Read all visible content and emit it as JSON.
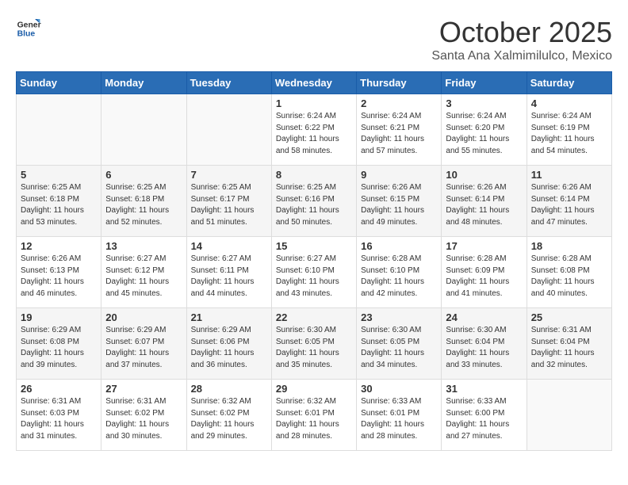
{
  "header": {
    "logo_line1": "General",
    "logo_line2": "Blue",
    "month": "October 2025",
    "location": "Santa Ana Xalmimilulco, Mexico"
  },
  "weekdays": [
    "Sunday",
    "Monday",
    "Tuesday",
    "Wednesday",
    "Thursday",
    "Friday",
    "Saturday"
  ],
  "weeks": [
    [
      {
        "day": "",
        "sunrise": "",
        "sunset": "",
        "daylight": ""
      },
      {
        "day": "",
        "sunrise": "",
        "sunset": "",
        "daylight": ""
      },
      {
        "day": "",
        "sunrise": "",
        "sunset": "",
        "daylight": ""
      },
      {
        "day": "1",
        "sunrise": "6:24 AM",
        "sunset": "6:22 PM",
        "daylight": "11 hours and 58 minutes."
      },
      {
        "day": "2",
        "sunrise": "6:24 AM",
        "sunset": "6:21 PM",
        "daylight": "11 hours and 57 minutes."
      },
      {
        "day": "3",
        "sunrise": "6:24 AM",
        "sunset": "6:20 PM",
        "daylight": "11 hours and 55 minutes."
      },
      {
        "day": "4",
        "sunrise": "6:24 AM",
        "sunset": "6:19 PM",
        "daylight": "11 hours and 54 minutes."
      }
    ],
    [
      {
        "day": "5",
        "sunrise": "6:25 AM",
        "sunset": "6:18 PM",
        "daylight": "11 hours and 53 minutes."
      },
      {
        "day": "6",
        "sunrise": "6:25 AM",
        "sunset": "6:18 PM",
        "daylight": "11 hours and 52 minutes."
      },
      {
        "day": "7",
        "sunrise": "6:25 AM",
        "sunset": "6:17 PM",
        "daylight": "11 hours and 51 minutes."
      },
      {
        "day": "8",
        "sunrise": "6:25 AM",
        "sunset": "6:16 PM",
        "daylight": "11 hours and 50 minutes."
      },
      {
        "day": "9",
        "sunrise": "6:26 AM",
        "sunset": "6:15 PM",
        "daylight": "11 hours and 49 minutes."
      },
      {
        "day": "10",
        "sunrise": "6:26 AM",
        "sunset": "6:14 PM",
        "daylight": "11 hours and 48 minutes."
      },
      {
        "day": "11",
        "sunrise": "6:26 AM",
        "sunset": "6:14 PM",
        "daylight": "11 hours and 47 minutes."
      }
    ],
    [
      {
        "day": "12",
        "sunrise": "6:26 AM",
        "sunset": "6:13 PM",
        "daylight": "11 hours and 46 minutes."
      },
      {
        "day": "13",
        "sunrise": "6:27 AM",
        "sunset": "6:12 PM",
        "daylight": "11 hours and 45 minutes."
      },
      {
        "day": "14",
        "sunrise": "6:27 AM",
        "sunset": "6:11 PM",
        "daylight": "11 hours and 44 minutes."
      },
      {
        "day": "15",
        "sunrise": "6:27 AM",
        "sunset": "6:10 PM",
        "daylight": "11 hours and 43 minutes."
      },
      {
        "day": "16",
        "sunrise": "6:28 AM",
        "sunset": "6:10 PM",
        "daylight": "11 hours and 42 minutes."
      },
      {
        "day": "17",
        "sunrise": "6:28 AM",
        "sunset": "6:09 PM",
        "daylight": "11 hours and 41 minutes."
      },
      {
        "day": "18",
        "sunrise": "6:28 AM",
        "sunset": "6:08 PM",
        "daylight": "11 hours and 40 minutes."
      }
    ],
    [
      {
        "day": "19",
        "sunrise": "6:29 AM",
        "sunset": "6:08 PM",
        "daylight": "11 hours and 39 minutes."
      },
      {
        "day": "20",
        "sunrise": "6:29 AM",
        "sunset": "6:07 PM",
        "daylight": "11 hours and 37 minutes."
      },
      {
        "day": "21",
        "sunrise": "6:29 AM",
        "sunset": "6:06 PM",
        "daylight": "11 hours and 36 minutes."
      },
      {
        "day": "22",
        "sunrise": "6:30 AM",
        "sunset": "6:05 PM",
        "daylight": "11 hours and 35 minutes."
      },
      {
        "day": "23",
        "sunrise": "6:30 AM",
        "sunset": "6:05 PM",
        "daylight": "11 hours and 34 minutes."
      },
      {
        "day": "24",
        "sunrise": "6:30 AM",
        "sunset": "6:04 PM",
        "daylight": "11 hours and 33 minutes."
      },
      {
        "day": "25",
        "sunrise": "6:31 AM",
        "sunset": "6:04 PM",
        "daylight": "11 hours and 32 minutes."
      }
    ],
    [
      {
        "day": "26",
        "sunrise": "6:31 AM",
        "sunset": "6:03 PM",
        "daylight": "11 hours and 31 minutes."
      },
      {
        "day": "27",
        "sunrise": "6:31 AM",
        "sunset": "6:02 PM",
        "daylight": "11 hours and 30 minutes."
      },
      {
        "day": "28",
        "sunrise": "6:32 AM",
        "sunset": "6:02 PM",
        "daylight": "11 hours and 29 minutes."
      },
      {
        "day": "29",
        "sunrise": "6:32 AM",
        "sunset": "6:01 PM",
        "daylight": "11 hours and 28 minutes."
      },
      {
        "day": "30",
        "sunrise": "6:33 AM",
        "sunset": "6:01 PM",
        "daylight": "11 hours and 28 minutes."
      },
      {
        "day": "31",
        "sunrise": "6:33 AM",
        "sunset": "6:00 PM",
        "daylight": "11 hours and 27 minutes."
      },
      {
        "day": "",
        "sunrise": "",
        "sunset": "",
        "daylight": ""
      }
    ]
  ]
}
